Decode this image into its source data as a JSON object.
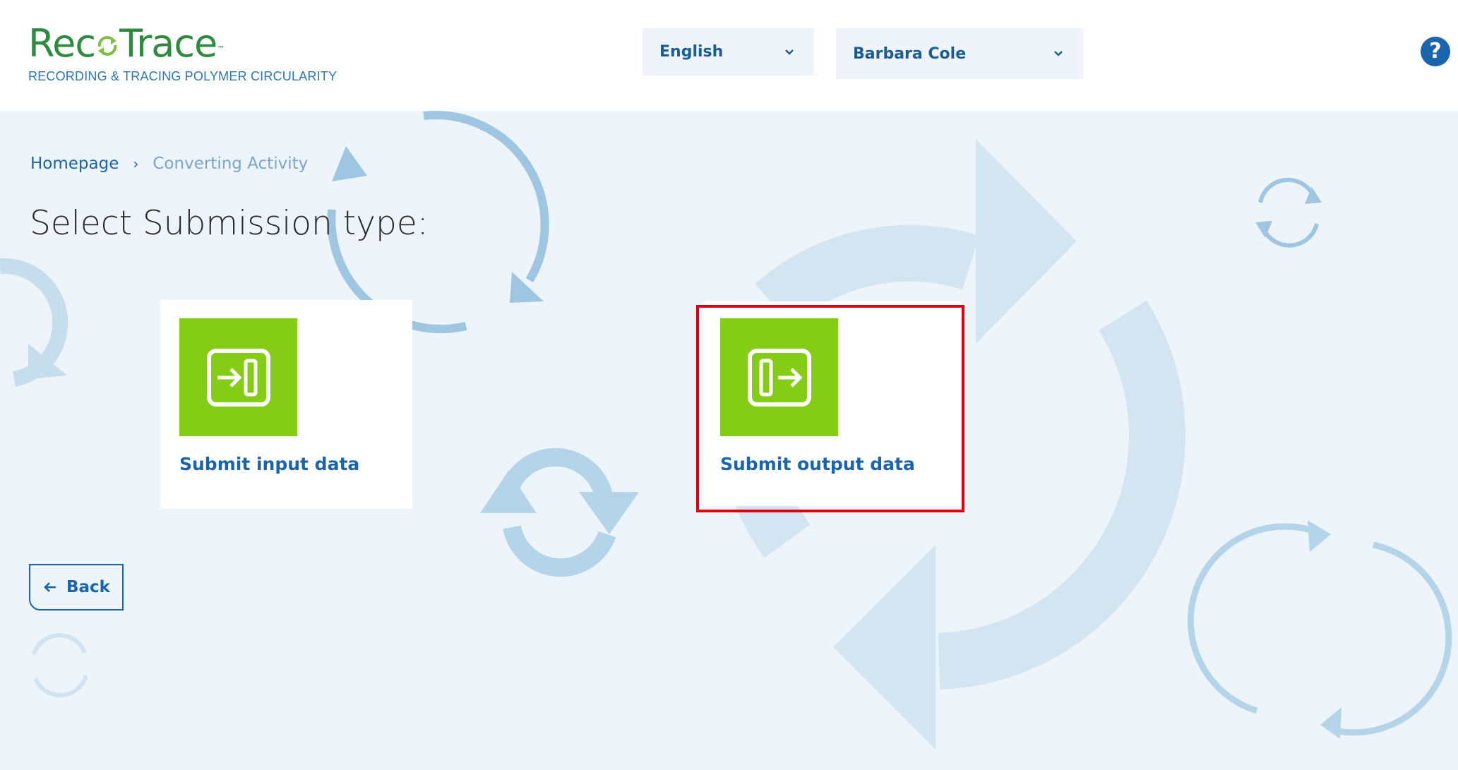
{
  "header": {
    "logo": {
      "word_pre": "Rec",
      "word_post": "Trace",
      "trademark": "™",
      "tagline": "RECORDING & TRACING POLYMER CIRCULARITY"
    },
    "language": {
      "selected": "English"
    },
    "user": {
      "name": "Barbara Cole"
    },
    "help_glyph": "?"
  },
  "breadcrumb": {
    "home": "Homepage",
    "separator": "›",
    "current": "Converting Activity"
  },
  "page_title": "Select Submission type:",
  "cards": [
    {
      "label": "Submit input data",
      "icon": "import-arrow-icon"
    },
    {
      "label": "Submit output data",
      "icon": "export-arrow-icon"
    }
  ],
  "back_button": {
    "label": "Back",
    "icon": "arrow-left-icon"
  },
  "colors": {
    "brand_green": "#2e8b3e",
    "brand_blue": "#1a64ad",
    "tile_green": "#84cc16",
    "highlight_red": "#e0000f",
    "page_bg": "#edf4fa",
    "decor_blue": "#8fbfe0"
  }
}
